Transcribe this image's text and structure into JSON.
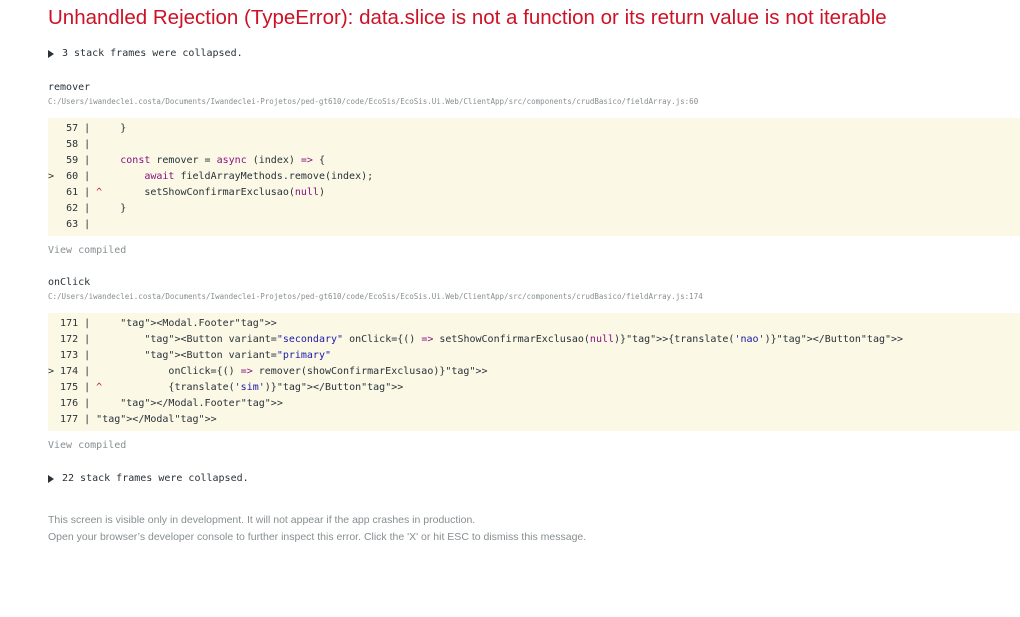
{
  "error": {
    "title": "Unhandled Rejection (TypeError): data.slice is not a function or its return value is not iterable"
  },
  "collapsed_top": {
    "label": "3 stack frames were collapsed."
  },
  "frames": [
    {
      "function_name": "remover",
      "file_path": "C:/Users/iwandeclei.costa/Documents/Iwandeclei-Projetos/ped-gt610/code/EcoSis/EcoSis.Ui.Web/ClientApp/src/components/crudBasico/fieldArray.js:60",
      "lines": [
        {
          "marker": "  ",
          "num": "57",
          "sep": " |",
          "code": "     }"
        },
        {
          "marker": "  ",
          "num": "58",
          "sep": " |",
          "code": ""
        },
        {
          "marker": "  ",
          "num": "59",
          "sep": " |",
          "code": "     const remover = async (index) => {"
        },
        {
          "marker": "> ",
          "num": "60",
          "sep": " |",
          "code": "         await fieldArrayMethods.remove(index);"
        },
        {
          "marker": "  ",
          "num": "61",
          "sep": " | ^",
          "code": "       setShowConfirmarExclusao(null)"
        },
        {
          "marker": "  ",
          "num": "62",
          "sep": " |",
          "code": "     }"
        },
        {
          "marker": "  ",
          "num": "63",
          "sep": " |",
          "code": ""
        }
      ],
      "view_compiled": "View compiled"
    },
    {
      "function_name": "onClick",
      "file_path": "C:/Users/iwandeclei.costa/Documents/Iwandeclei-Projetos/ped-gt610/code/EcoSis/EcoSis.Ui.Web/ClientApp/src/components/crudBasico/fieldArray.js:174",
      "lines": [
        {
          "marker": "  ",
          "num": "171",
          "sep": " |",
          "code": "     <Modal.Footer>"
        },
        {
          "marker": "  ",
          "num": "172",
          "sep": " |",
          "code": "         <Button variant=\"secondary\" onClick={() => setShowConfirmarExclusao(null)}>{translate('nao')}</Button>"
        },
        {
          "marker": "  ",
          "num": "173",
          "sep": " |",
          "code": "         <Button variant=\"primary\""
        },
        {
          "marker": "> ",
          "num": "174",
          "sep": " |",
          "code": "             onClick={() => remover(showConfirmarExclusao)}>"
        },
        {
          "marker": "  ",
          "num": "175",
          "sep": " | ^",
          "code": "           {translate('sim')}</Button>"
        },
        {
          "marker": "  ",
          "num": "176",
          "sep": " |",
          "code": "     </Modal.Footer>"
        },
        {
          "marker": "  ",
          "num": "177",
          "sep": " |",
          "code": " </Modal>"
        }
      ],
      "view_compiled": "View compiled"
    }
  ],
  "collapsed_bottom": {
    "label": "22 stack frames were collapsed."
  },
  "footer": {
    "line1": "This screen is visible only in development. It will not appear if the app crashes in production.",
    "line2": "Open your browser’s developer console to further inspect this error.  Click the 'X' or hit ESC to dismiss this message."
  }
}
